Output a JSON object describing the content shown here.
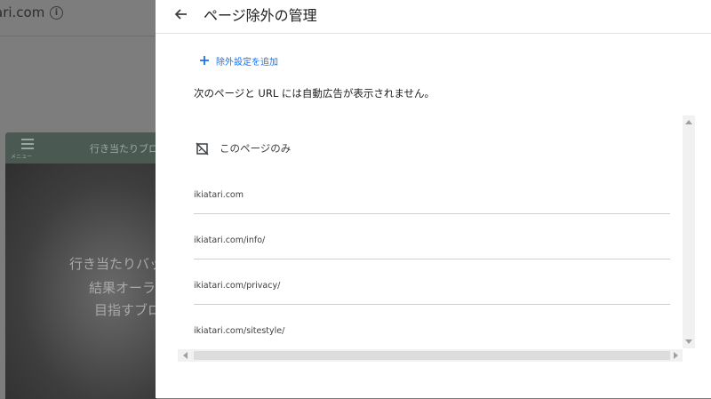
{
  "background": {
    "site_name": "ari.com",
    "info_icon": "info-icon",
    "preview": {
      "menu_label": "メニュー",
      "site_title": "行き当たりブロ",
      "lines": [
        "行き当たりバッ",
        "結果オーラ",
        "目指すブロ"
      ]
    }
  },
  "dialog": {
    "back_icon": "arrow-left-icon",
    "title": "ページ除外の管理",
    "add_button": {
      "icon": "plus-icon",
      "label": "除外設定を追加"
    },
    "description": "次のページと URL には自動広告が表示されません。",
    "list": {
      "header_icon": "page-off-icon",
      "header_label": "このページのみ",
      "items": [
        "ikiatari.com",
        "ikiatari.com/info/",
        "ikiatari.com/privacy/",
        "ikiatari.com/sitestyle/"
      ]
    }
  },
  "colors": {
    "accent": "#1a73e8",
    "overlay": "#7d7d7d",
    "text": "#202124"
  }
}
